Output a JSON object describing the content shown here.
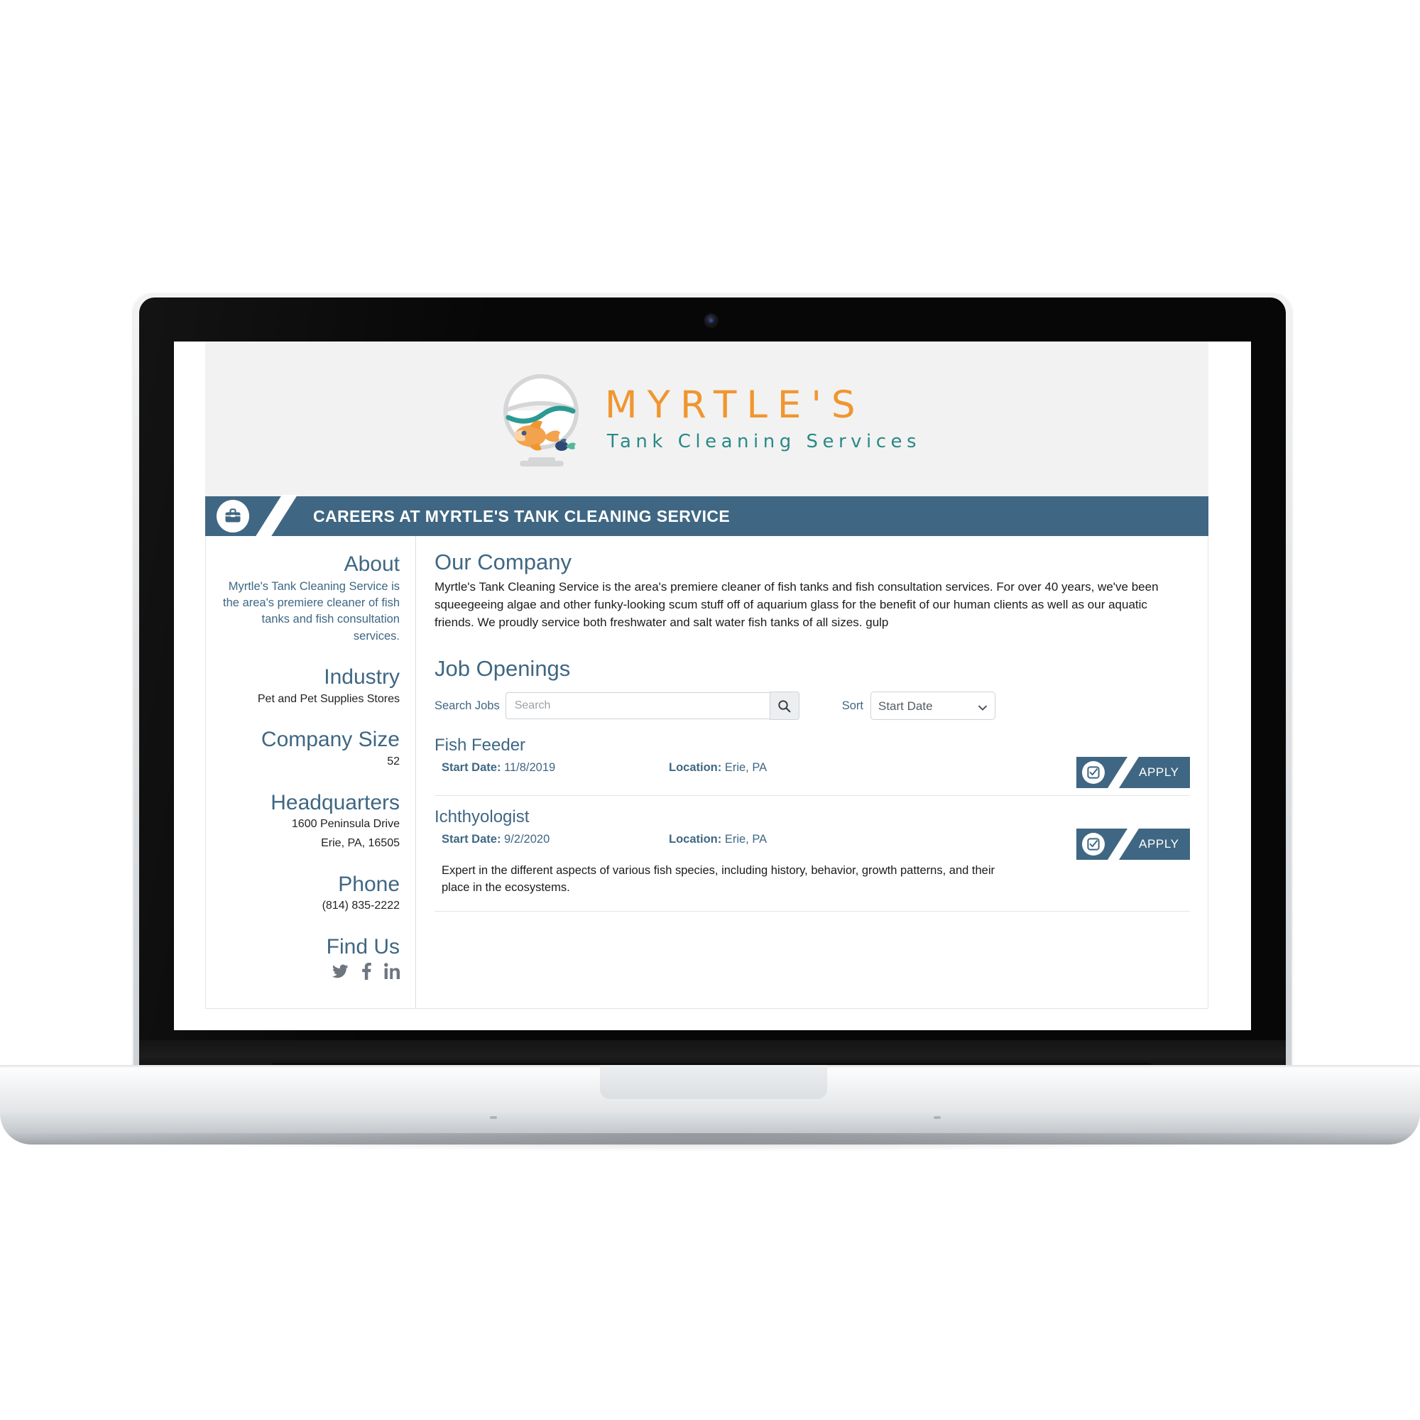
{
  "logo": {
    "brand": "MYRTLE'S",
    "tagline": "Tank Cleaning Services",
    "brand_color": "#f0962f",
    "tagline_color": "#2a8a86",
    "bowl_icon": "fishbowl-icon"
  },
  "banner": {
    "icon": "briefcase-icon",
    "title": "CAREERS AT MYRTLE'S TANK CLEANING SERVICE",
    "background": "#3f6783"
  },
  "sidebar": {
    "about_heading": "About",
    "about_text": "Myrtle's Tank Cleaning Service is the area's premiere cleaner of fish tanks and fish consultation services.",
    "industry_heading": "Industry",
    "industry_value": "Pet and Pet Supplies Stores",
    "company_size_heading": "Company Size",
    "company_size_value": "52",
    "headquarters_heading": "Headquarters",
    "headquarters_line1": "1600 Peninsula Drive",
    "headquarters_line2": "Erie, PA, 16505",
    "phone_heading": "Phone",
    "phone_value": "(814) 835-2222",
    "find_us_heading": "Find Us",
    "socials": [
      {
        "name": "twitter-icon",
        "label": "Twitter"
      },
      {
        "name": "facebook-icon",
        "label": "Facebook"
      },
      {
        "name": "linkedin-icon",
        "label": "LinkedIn"
      }
    ]
  },
  "main": {
    "company_heading": "Our Company",
    "company_text": "Myrtle's Tank Cleaning Service is the area's premiere cleaner of fish tanks and fish consultation services. For over 40 years, we've been squeegeeing algae and other funky-looking scum stuff off of aquarium glass for the benefit of our human clients as well as our aquatic friends. We proudly service both freshwater and salt water fish tanks of all sizes. gulp",
    "jobs_heading": "Job Openings",
    "search": {
      "label": "Search Jobs",
      "placeholder": "Search",
      "value": "",
      "button_icon": "search-icon"
    },
    "sort": {
      "label": "Sort",
      "selected": "Start Date",
      "options": [
        "Start Date"
      ],
      "caret_icon": "chevron-down-icon"
    },
    "jobs": [
      {
        "title": "Fish Feeder",
        "start_label": "Start Date:",
        "start_value": "11/8/2019",
        "location_label": "Location:",
        "location_value": "Erie, PA",
        "description": "",
        "apply_label": "APPLY",
        "apply_icon": "checkbox-clipboard-icon"
      },
      {
        "title": "Ichthyologist",
        "start_label": "Start Date:",
        "start_value": "9/2/2020",
        "location_label": "Location:",
        "location_value": "Erie, PA",
        "description": "Expert in the different aspects of various fish species, including history, behavior, growth patterns, and their place in the ecosystems.",
        "apply_label": "APPLY",
        "apply_icon": "checkbox-clipboard-icon"
      }
    ]
  },
  "device": {
    "type": "laptop",
    "webcam": "webcam-icon"
  }
}
